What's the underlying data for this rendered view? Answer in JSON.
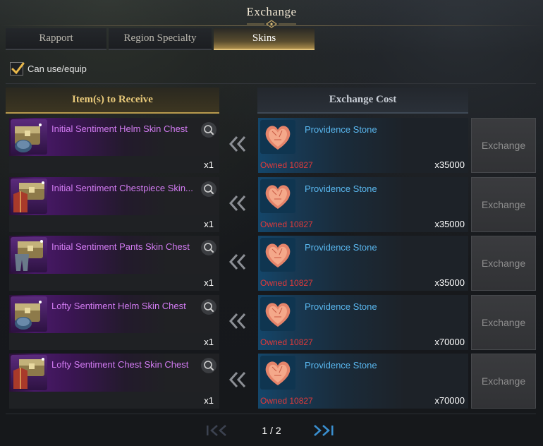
{
  "window": {
    "title": "Exchange"
  },
  "tabs": [
    {
      "label": "Rapport",
      "active": false
    },
    {
      "label": "Region Specialty",
      "active": false
    },
    {
      "label": "Skins",
      "active": true
    }
  ],
  "filter": {
    "label": "Can use/equip",
    "checked": true
  },
  "columns": {
    "receive": "Item(s) to Receive",
    "cost": "Exchange Cost"
  },
  "rows": [
    {
      "item": "Initial Sentiment Helm Skin Chest",
      "item_type": "helm",
      "qty": "x1",
      "cost_name": "Providence Stone",
      "owned": "Owned 10827",
      "cost_qty": "x35000",
      "button": "Exchange"
    },
    {
      "item": "Initial Sentiment Chestpiece Skin...",
      "item_type": "chest",
      "qty": "x1",
      "cost_name": "Providence Stone",
      "owned": "Owned 10827",
      "cost_qty": "x35000",
      "button": "Exchange"
    },
    {
      "item": "Initial Sentiment Pants Skin Chest",
      "item_type": "pants",
      "qty": "x1",
      "cost_name": "Providence Stone",
      "owned": "Owned 10827",
      "cost_qty": "x35000",
      "button": "Exchange"
    },
    {
      "item": "Lofty Sentiment Helm Skin Chest",
      "item_type": "helm",
      "qty": "x1",
      "cost_name": "Providence Stone",
      "owned": "Owned 10827",
      "cost_qty": "x70000",
      "button": "Exchange"
    },
    {
      "item": "Lofty Sentiment Chest Skin Chest",
      "item_type": "chest",
      "qty": "x1",
      "cost_name": "Providence Stone",
      "owned": "Owned 10827",
      "cost_qty": "x70000",
      "button": "Exchange"
    }
  ],
  "pagination": {
    "text": "1 / 2"
  },
  "colors": {
    "item_name": "#d27bf2",
    "cost_name": "#5ab8f0",
    "owned_insufficient": "#e23a3a",
    "active_tab_accent": "#e2c27a",
    "pager_arrows": "#3a8fd0"
  }
}
